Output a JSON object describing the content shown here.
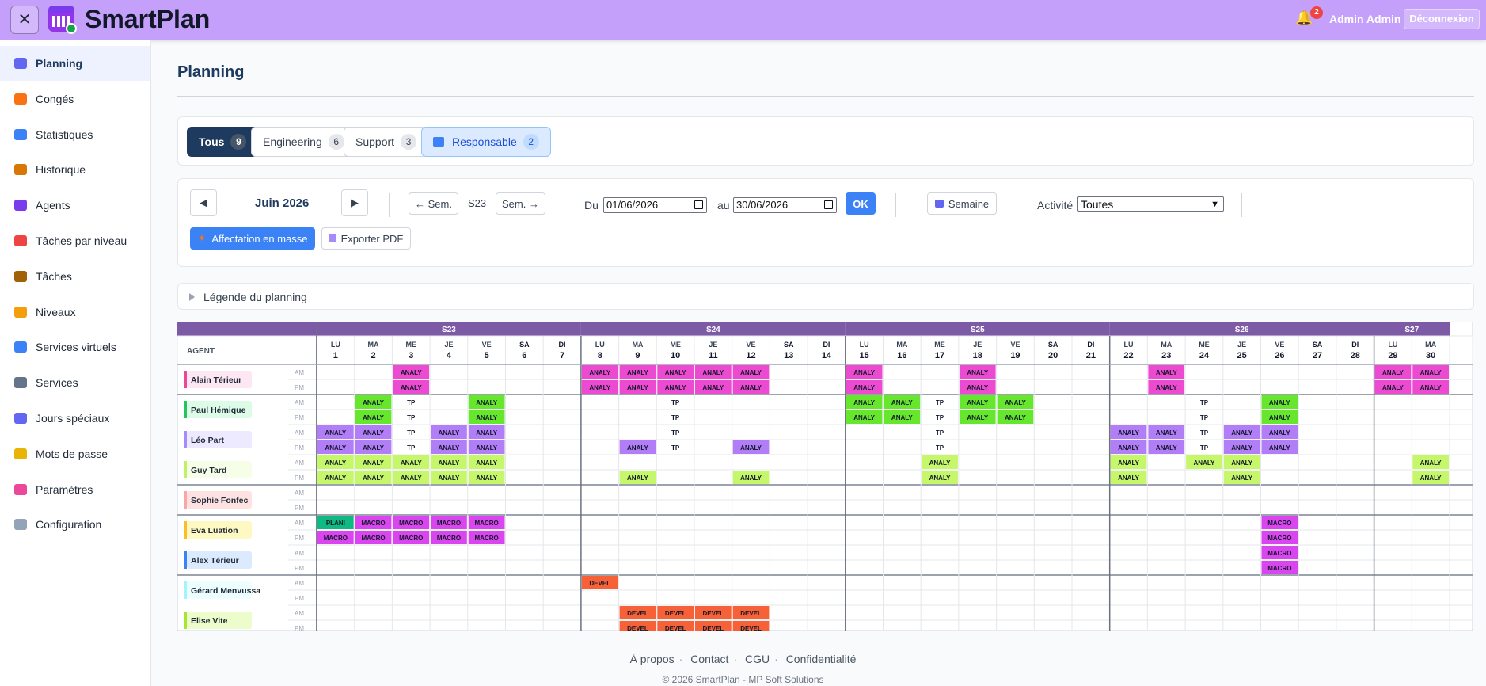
{
  "app": {
    "title": "SmartPlan",
    "user": "Admin Admin",
    "logout_label": "Déconnexion",
    "notifications": "2"
  },
  "sidebar": {
    "items": [
      {
        "label": "Planning",
        "icon": "calendar-icon",
        "active": true,
        "color": "#6366f1"
      },
      {
        "label": "Congés",
        "icon": "vacation-icon",
        "color": "#f97316"
      },
      {
        "label": "Statistiques",
        "icon": "chart-icon",
        "color": "#3b82f6"
      },
      {
        "label": "Historique",
        "icon": "scroll-icon",
        "color": "#d97706"
      },
      {
        "label": "Agents",
        "icon": "users-icon",
        "color": "#7c3aed"
      },
      {
        "label": "Tâches par niveau",
        "icon": "target-icon",
        "color": "#ef4444"
      },
      {
        "label": "Tâches",
        "icon": "clipboard-icon",
        "color": "#a16207"
      },
      {
        "label": "Niveaux",
        "icon": "tag-icon",
        "color": "#f59e0b"
      },
      {
        "label": "Services virtuels",
        "icon": "shuffle-icon",
        "color": "#3b82f6"
      },
      {
        "label": "Services",
        "icon": "building-icon",
        "color": "#64748b"
      },
      {
        "label": "Jours spéciaux",
        "icon": "calendar-special-icon",
        "color": "#6366f1"
      },
      {
        "label": "Mots de passe",
        "icon": "key-icon",
        "color": "#eab308"
      },
      {
        "label": "Paramètres",
        "icon": "palette-icon",
        "color": "#ec4899"
      },
      {
        "label": "Configuration",
        "icon": "wrench-icon",
        "color": "#94a3b8"
      }
    ]
  },
  "page": {
    "title": "Planning"
  },
  "filters": {
    "tabs": [
      {
        "label": "Tous",
        "count": "9",
        "style": "dark"
      },
      {
        "label": "Engineering",
        "count": "6"
      },
      {
        "label": "Support",
        "count": "3"
      },
      {
        "label": "Responsable",
        "count": "2",
        "style": "blue"
      }
    ]
  },
  "toolbar": {
    "month": "Juin 2026",
    "prev_week": "← Sem.",
    "week_label": "S23",
    "next_week": "Sem. →",
    "from_label": "Du",
    "from_value": "01/06/2026",
    "to_label": "au",
    "to_value": "30/06/2026",
    "ok": "OK",
    "view": "Semaine",
    "activity_label": "Activité",
    "activity_value": "Toutes",
    "mass_assign": "Affectation en masse",
    "export_pdf": "Exporter PDF"
  },
  "legend": {
    "label": "Légende du planning"
  },
  "colors": {
    "ANALY": "#ec4ad1",
    "TP": "#ffffff",
    "PLANI": "#10b981",
    "MACRO": "#d946ef",
    "DEVEL": "#f76138"
  },
  "grid": {
    "agent_header": "AGENT",
    "weeks": [
      {
        "label": "S23",
        "span": 7
      },
      {
        "label": "S24",
        "span": 7
      },
      {
        "label": "S25",
        "span": 7
      },
      {
        "label": "S26",
        "span": 7
      },
      {
        "label": "S27",
        "span": 2
      }
    ],
    "days": [
      [
        "LU",
        "1"
      ],
      [
        "MA",
        "2"
      ],
      [
        "ME",
        "3"
      ],
      [
        "JE",
        "4"
      ],
      [
        "VE",
        "5"
      ],
      [
        "SA",
        "6"
      ],
      [
        "DI",
        "7"
      ],
      [
        "LU",
        "8"
      ],
      [
        "MA",
        "9"
      ],
      [
        "ME",
        "10"
      ],
      [
        "JE",
        "11"
      ],
      [
        "VE",
        "12"
      ],
      [
        "SA",
        "13"
      ],
      [
        "DI",
        "14"
      ],
      [
        "LU",
        "15"
      ],
      [
        "MA",
        "16"
      ],
      [
        "ME",
        "17"
      ],
      [
        "JE",
        "18"
      ],
      [
        "VE",
        "19"
      ],
      [
        "SA",
        "20"
      ],
      [
        "DI",
        "21"
      ],
      [
        "LU",
        "22"
      ],
      [
        "MA",
        "23"
      ],
      [
        "ME",
        "24"
      ],
      [
        "JE",
        "25"
      ],
      [
        "VE",
        "26"
      ],
      [
        "SA",
        "27"
      ],
      [
        "DI",
        "28"
      ],
      [
        "LU",
        "29"
      ],
      [
        "MA",
        "30"
      ]
    ],
    "am_label": "AM",
    "pm_label": "PM",
    "agents": [
      {
        "name": "Alain Térieur",
        "color": "#ec4899",
        "bg": "#fce7f3",
        "group_start": true,
        "am": {
          "2": "ANALY",
          "7": "ANALY",
          "8": "ANALY",
          "9": "ANALY",
          "10": "ANALY",
          "11": "ANALY",
          "14": "ANALY",
          "17": "ANALY",
          "22": "ANALY",
          "28": "ANALY",
          "29": "ANALY"
        },
        "pm": {
          "2": "ANALY",
          "7": "ANALY",
          "8": "ANALY",
          "9": "ANALY",
          "10": "ANALY",
          "11": "ANALY",
          "14": "ANALY",
          "17": "ANALY",
          "22": "ANALY",
          "28": "ANALY",
          "29": "ANALY"
        }
      },
      {
        "name": "Paul Hémique",
        "color": "#22c55e",
        "bg": "#dcfce7",
        "group_start": true,
        "pal": "green",
        "am": {
          "1": "ANALY",
          "2": "TP",
          "4": "ANALY",
          "9": "TP",
          "14": "ANALY",
          "15": "ANALY",
          "16": "TP",
          "17": "ANALY",
          "18": "ANALY",
          "23": "TP",
          "25": "ANALY"
        },
        "pm": {
          "1": "ANALY",
          "2": "TP",
          "4": "ANALY",
          "9": "TP",
          "14": "ANALY",
          "15": "ANALY",
          "16": "TP",
          "17": "ANALY",
          "18": "ANALY",
          "23": "TP",
          "25": "ANALY"
        }
      },
      {
        "name": "Léo Part",
        "color": "#a78bfa",
        "bg": "#ede9fe",
        "pal": "purple",
        "am": {
          "0": "ANALY",
          "1": "ANALY",
          "2": "TP",
          "3": "ANALY",
          "4": "ANALY",
          "9": "TP",
          "16": "TP",
          "21": "ANALY",
          "22": "ANALY",
          "23": "TP",
          "24": "ANALY",
          "25": "ANALY"
        },
        "pm": {
          "0": "ANALY",
          "1": "ANALY",
          "2": "TP",
          "3": "ANALY",
          "4": "ANALY",
          "8": "ANALY",
          "9": "TP",
          "11": "ANALY",
          "16": "TP",
          "21": "ANALY",
          "22": "ANALY",
          "23": "TP",
          "24": "ANALY",
          "25": "ANALY"
        }
      },
      {
        "name": "Guy Tard",
        "color": "#bef264",
        "bg": "#f7fee7",
        "pal": "lime",
        "am": {
          "0": "ANALY",
          "1": "ANALY",
          "2": "ANALY",
          "3": "ANALY",
          "4": "ANALY",
          "16": "ANALY",
          "21": "ANALY",
          "23": "ANALY",
          "24": "ANALY",
          "29": "ANALY"
        },
        "pm": {
          "0": "ANALY",
          "1": "ANALY",
          "2": "ANALY",
          "3": "ANALY",
          "4": "ANALY",
          "8": "ANALY",
          "11": "ANALY",
          "16": "ANALY",
          "21": "ANALY",
          "24": "ANALY",
          "29": "ANALY"
        }
      },
      {
        "name": "Sophie Fonfec",
        "color": "#fca5a5",
        "bg": "#fee2e2",
        "group_start": true,
        "am": {},
        "pm": {}
      },
      {
        "name": "Eva Luation",
        "color": "#fbbf24",
        "bg": "#fef9c3",
        "group_start": true,
        "am": {
          "0": "PLANI",
          "1": "MACRO",
          "2": "MACRO",
          "3": "MACRO",
          "4": "MACRO",
          "25": "MACRO"
        },
        "pm": {
          "0": "MACRO",
          "1": "MACRO",
          "2": "MACRO",
          "3": "MACRO",
          "4": "MACRO",
          "25": "MACRO"
        }
      },
      {
        "name": "Alex Térieur",
        "color": "#3b82f6",
        "bg": "#dbeafe",
        "am": {
          "25": "MACRO"
        },
        "pm": {
          "25": "MACRO"
        }
      },
      {
        "name": "Gérard Menvussa",
        "color": "#a5f3fc",
        "bg": "#ecfeff",
        "group_start": true,
        "am": {
          "7": "DEVEL"
        },
        "pm": {}
      },
      {
        "name": "Elise Vite",
        "color": "#a3e635",
        "bg": "#ecfccb",
        "am": {
          "8": "DEVEL",
          "9": "DEVEL",
          "10": "DEVEL",
          "11": "DEVEL"
        },
        "pm": {
          "8": "DEVEL",
          "9": "DEVEL",
          "10": "DEVEL",
          "11": "DEVEL"
        }
      }
    ]
  },
  "footer": {
    "links": [
      "À propos",
      "Contact",
      "CGU",
      "Confidentialité"
    ],
    "copyright": "© 2026 SmartPlan - MP Soft Solutions"
  }
}
